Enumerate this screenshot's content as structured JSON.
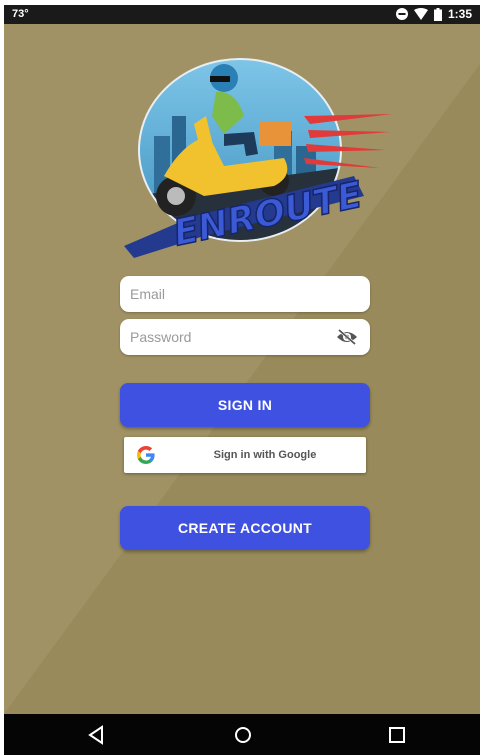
{
  "status_bar": {
    "temperature": "73°",
    "time": "1:35",
    "icons": [
      "do-not-disturb-icon",
      "wifi-icon",
      "battery-icon"
    ]
  },
  "logo": {
    "text": "ENROUTE",
    "icon": "scooter-delivery-logo"
  },
  "form": {
    "email": {
      "placeholder": "Email",
      "value": ""
    },
    "password": {
      "placeholder": "Password",
      "value": "",
      "toggle_icon": "eye-off-icon"
    },
    "sign_in_label": "SIGN IN",
    "google_label": "Sign in with Google",
    "google_icon": "google-icon",
    "create_account_label": "CREATE ACCOUNT"
  },
  "nav_bar": {
    "buttons": [
      "back-icon",
      "home-icon",
      "recents-icon"
    ]
  },
  "colors": {
    "background": "#9b8c5e",
    "primary": "#3f51e0",
    "status_bar": "#1a1a1a",
    "nav_bar": "#050505"
  }
}
